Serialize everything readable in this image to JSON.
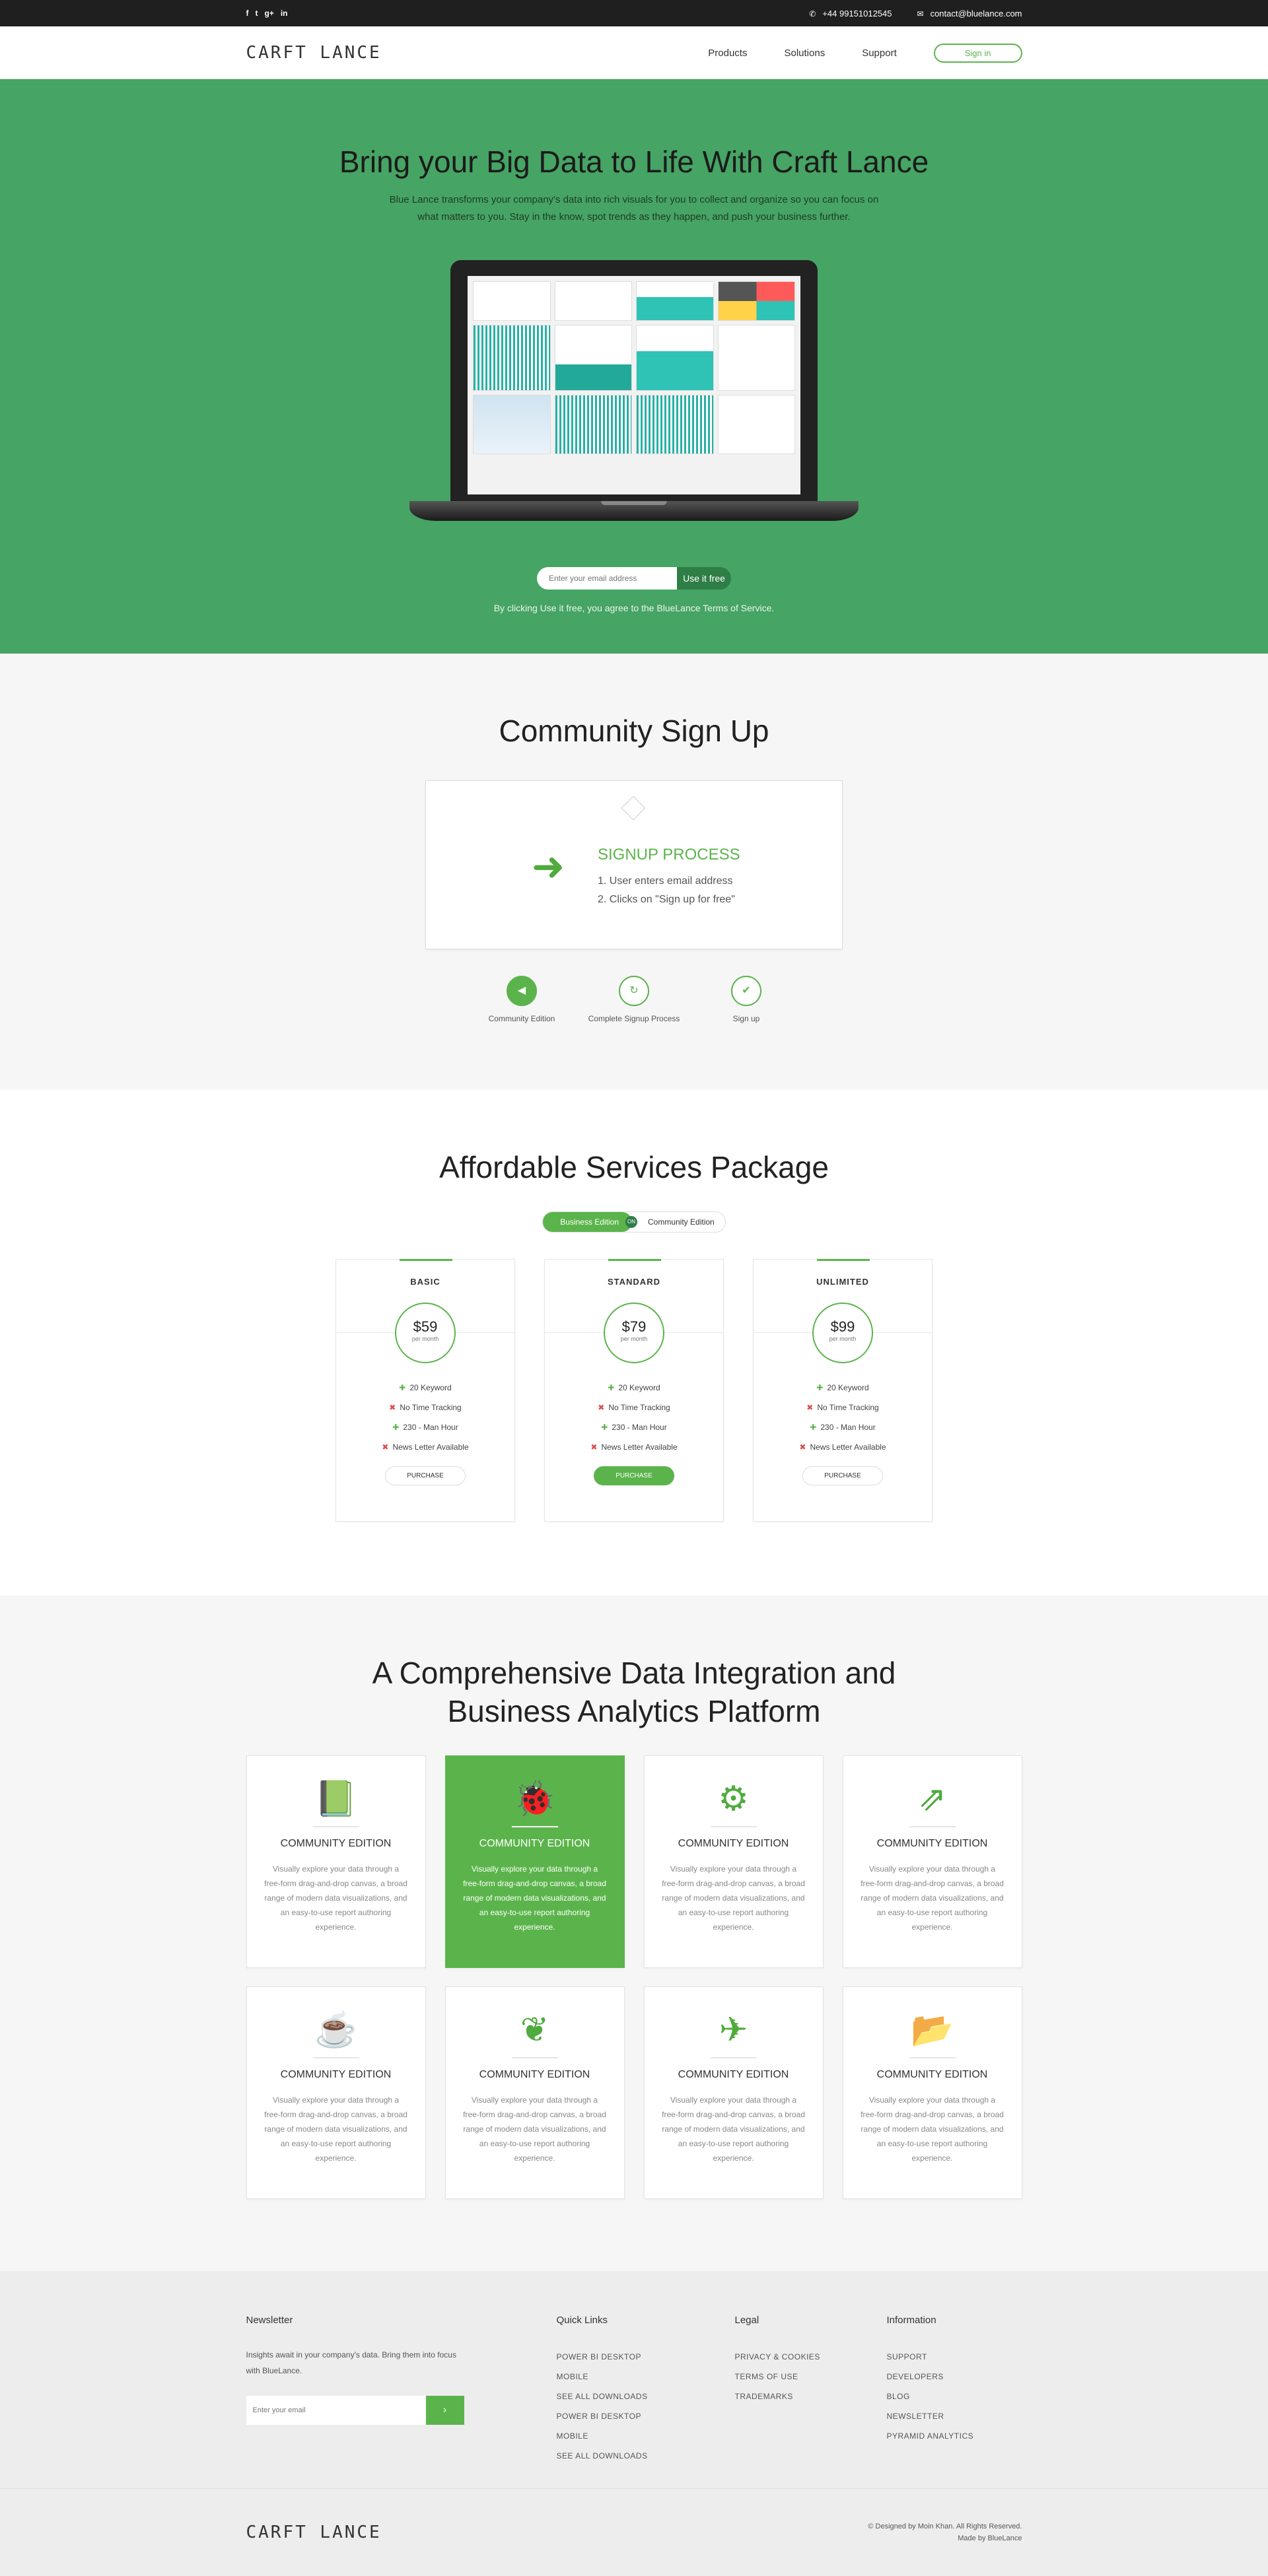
{
  "topbar": {
    "social": [
      "f",
      "t",
      "g+",
      "in"
    ],
    "phone_icon": "phone-icon",
    "phone": "+44 99151012545",
    "email_icon": "envelope-icon",
    "email": "contact@bluelance.com"
  },
  "nav": {
    "logo": "CARFT LANCE",
    "items": [
      "Products",
      "Solutions",
      "Support"
    ],
    "signin": "Sign in"
  },
  "hero": {
    "title": "Bring your Big Data to Life With Craft Lance",
    "subtitle": "Blue Lance transforms your company's data into rich visuals for you to collect and organize so you can focus on what matters to you. Stay in the know, spot trends as they happen, and push your business further.",
    "email_placeholder": "Enter your email address",
    "cta": "Use it free",
    "terms": "By clicking Use it free, you agree to the  BlueLance Terms of Service."
  },
  "community": {
    "title": "Community Sign Up",
    "process_title": "SIGNUP PROCESS",
    "process_steps": [
      "1.  User enters email address",
      "2.  Clicks on \"Sign up for free\""
    ],
    "steps": [
      {
        "label": "Community Edition",
        "icon": "volume-icon"
      },
      {
        "label": "Complete Signup Process",
        "icon": "refresh-icon"
      },
      {
        "label": "Sign up",
        "icon": "check-icon"
      }
    ]
  },
  "pricing": {
    "title": "Affordable Services Package",
    "toggle_on": "Business Edition",
    "toggle_knob": "ON",
    "toggle_off": "Community Edition",
    "plans": [
      {
        "name": "BASIC",
        "price": "$59",
        "period": "per month",
        "button": "PURCHASE",
        "features": [
          {
            "text": "20 Keyword",
            "ok": true
          },
          {
            "text": "No Time Tracking",
            "ok": false
          },
          {
            "text": "230 - Man Hour",
            "ok": true
          },
          {
            "text": "News Letter Available",
            "ok": false
          }
        ]
      },
      {
        "name": "STANDARD",
        "price": "$79",
        "period": "per month",
        "button": "PURCHASE",
        "features": [
          {
            "text": "20 Keyword",
            "ok": true
          },
          {
            "text": "No Time Tracking",
            "ok": false
          },
          {
            "text": "230 - Man Hour",
            "ok": true
          },
          {
            "text": "News Letter Available",
            "ok": false
          }
        ]
      },
      {
        "name": "UNLIMITED",
        "price": "$99",
        "period": "per month",
        "button": "PURCHASE",
        "features": [
          {
            "text": "20 Keyword",
            "ok": true
          },
          {
            "text": "No Time Tracking",
            "ok": false
          },
          {
            "text": "230 - Man Hour",
            "ok": true
          },
          {
            "text": "News Letter Available",
            "ok": false
          }
        ]
      }
    ]
  },
  "platform": {
    "title_line1": "A Comprehensive Data Integration and",
    "title_line2": "Business Analytics Platform",
    "cards": [
      {
        "icon": "book-icon",
        "title": "COMMUNITY EDITION",
        "text": "Visually explore your data through a free-form drag-and-drop canvas, a broad range of modern data visualizations, and an easy-to-use report authoring experience."
      },
      {
        "icon": "bug-icon",
        "title": "COMMUNITY EDITION",
        "text": "Visually explore your data through a free-form drag-and-drop canvas, a broad range of modern data visualizations, and an easy-to-use report authoring experience."
      },
      {
        "icon": "gears-icon",
        "title": "COMMUNITY EDITION",
        "text": "Visually explore your data through a free-form drag-and-drop canvas, a broad range of modern data visualizations, and an easy-to-use report authoring experience."
      },
      {
        "icon": "external-link-icon",
        "title": "COMMUNITY EDITION",
        "text": "Visually explore your data through a free-form drag-and-drop canvas, a broad range of modern data visualizations, and an easy-to-use report authoring experience."
      },
      {
        "icon": "coffee-icon",
        "title": "COMMUNITY EDITION",
        "text": "Visually explore your data through a free-form drag-and-drop canvas, a broad range of modern data visualizations, and an easy-to-use report authoring experience."
      },
      {
        "icon": "leaf-icon",
        "title": "COMMUNITY EDITION",
        "text": "Visually explore your data through a free-form drag-and-drop canvas, a broad range of modern data visualizations, and an easy-to-use report authoring experience."
      },
      {
        "icon": "paper-plane-icon",
        "title": "COMMUNITY EDITION",
        "text": "Visually explore your data through a free-form drag-and-drop canvas, a broad range of modern data visualizations, and an easy-to-use report authoring experience."
      },
      {
        "icon": "folder-open-icon",
        "title": "COMMUNITY EDITION",
        "text": "Visually explore your data through a free-form drag-and-drop canvas, a broad range of modern data visualizations, and an easy-to-use report authoring experience."
      }
    ]
  },
  "footer": {
    "newsletter_title": "Newsletter",
    "newsletter_text": "Insights await in your company's data. Bring them into focus with BlueLance.",
    "newsletter_placeholder": "Enter your email",
    "newsletter_button": "›",
    "quick_links_title": "Quick Links",
    "quick_links": [
      "POWER BI DESKTOP",
      "MOBILE",
      "SEE ALL DOWNLOADS",
      "POWER BI DESKTOP",
      "MOBILE",
      "SEE ALL DOWNLOADS"
    ],
    "legal_title": "Legal",
    "legal": [
      "PRIVACY & COOKIES",
      "TERMS OF USE",
      "TRADEMARKS"
    ],
    "info_title": "Information",
    "info": [
      "SUPPORT",
      "DEVELOPERS",
      "BLOG",
      "NEWSLETTER",
      "PYRAMID ANALYTICS"
    ],
    "logo": "CARFT LANCE",
    "copyright": "© Designed by Moin Khan. All Rights Reserved.",
    "made_by": "Made by BlueLance"
  },
  "colors": {
    "accent": "#5bb44b",
    "hero_bg": "#46a464",
    "topbar_bg": "#1f1f1f"
  }
}
